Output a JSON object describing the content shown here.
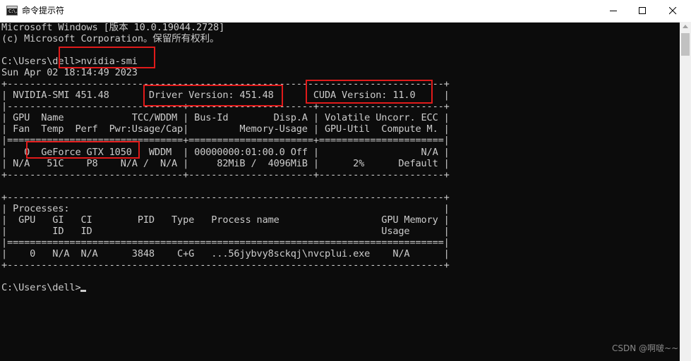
{
  "window": {
    "title": "命令提示符",
    "icon": "cmd-icon",
    "icon_text": "C:\\."
  },
  "console": {
    "lines": [
      "Microsoft Windows [版本 10.0.19044.2728]",
      "(c) Microsoft Corporation。保留所有权利。",
      "",
      "C:\\Users\\dell>nvidia-smi",
      "Sun Apr 02 18:14:49 2023",
      "+-----------------------------------------------------------------------------+",
      "| NVIDIA-SMI 451.48       Driver Version: 451.48       CUDA Version: 11.0     |",
      "|-------------------------------+----------------------+----------------------+",
      "| GPU  Name            TCC/WDDM | Bus-Id        Disp.A | Volatile Uncorr. ECC |",
      "| Fan  Temp  Perf  Pwr:Usage/Cap|         Memory-Usage | GPU-Util  Compute M. |",
      "|===============================+======================+======================|",
      "|   0  GeForce GTX 1050   WDDM  | 00000000:01:00.0 Off |                  N/A |",
      "| N/A   51C    P8    N/A /  N/A |     82MiB /  4096MiB |      2%      Default |",
      "+-------------------------------+----------------------+----------------------+",
      "",
      "+-----------------------------------------------------------------------------+",
      "| Processes:                                                                  |",
      "|  GPU   GI   CI        PID   Type   Process name                  GPU Memory |",
      "|        ID   ID                                                   Usage      |",
      "|=============================================================================|",
      "|    0   N/A  N/A      3848    C+G   ...56jybvy8sckqj\\nvcplui.exe    N/A      |",
      "+-----------------------------------------------------------------------------+",
      "",
      "C:\\Users\\dell>"
    ]
  },
  "watermark": "CSDN @啊啵~~",
  "colors": {
    "console_bg": "#0c0c0c",
    "console_fg": "#cccccc",
    "highlight_box": "#e01a1a"
  }
}
